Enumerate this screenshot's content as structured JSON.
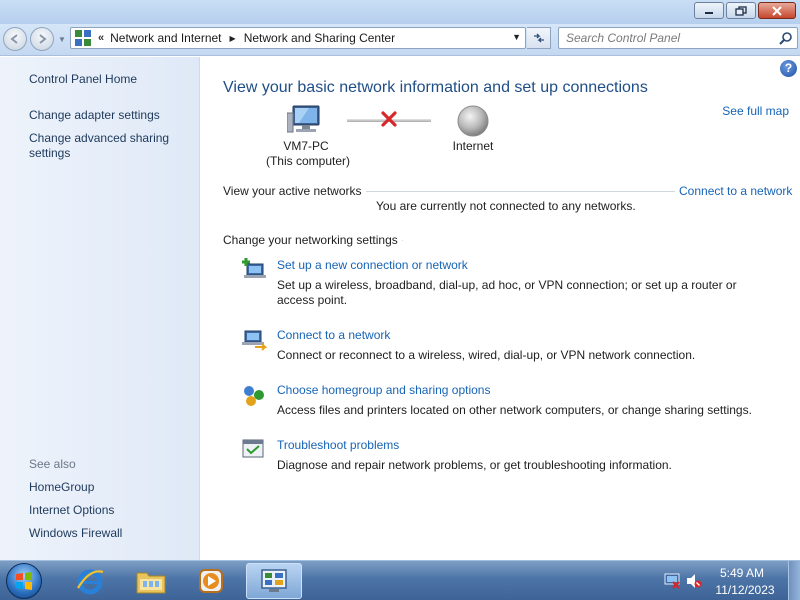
{
  "window": {
    "buttons": [
      "minimize",
      "maximize",
      "close"
    ]
  },
  "navigation": {
    "breadcrumb": [
      "Network and Internet",
      "Network and Sharing Center"
    ],
    "overflow_marker": "«",
    "search": {
      "placeholder": "Search Control Panel",
      "value": ""
    }
  },
  "sidebar": {
    "home": "Control Panel Home",
    "links": [
      "Change adapter settings",
      "Change advanced sharing",
      "settings"
    ],
    "see_also_label": "See also",
    "see_also": [
      "HomeGroup",
      "Internet Options",
      "Windows Firewall"
    ]
  },
  "main": {
    "help_label": "?",
    "title": "View your basic network information and set up connections",
    "see_full_map": "See full map",
    "map": {
      "computer_name": "VM7-PC",
      "computer_sub": "(This computer)",
      "destination": "Internet",
      "status": "disconnected"
    },
    "active_networks": {
      "heading": "View your active networks",
      "connect_link": "Connect to a network",
      "status_text": "You are currently not connected to any networks."
    },
    "settings": {
      "heading": "Change your networking settings",
      "tasks": [
        {
          "icon": "new-connection-icon",
          "link": "Set up a new connection or network",
          "desc": "Set up a wireless, broadband, dial-up, ad hoc, or VPN connection; or set up a router or access point."
        },
        {
          "icon": "connect-network-icon",
          "link": "Connect to a network",
          "desc": "Connect or reconnect to a wireless, wired, dial-up, or VPN network connection."
        },
        {
          "icon": "homegroup-icon",
          "link": "Choose homegroup and sharing options",
          "desc": "Access files and printers located on other network computers, or change sharing settings."
        },
        {
          "icon": "troubleshoot-icon",
          "link": "Troubleshoot problems",
          "desc": "Diagnose and repair network problems, or get troubleshooting information."
        }
      ]
    }
  },
  "taskbar": {
    "pinned": [
      "internet-explorer-icon",
      "windows-explorer-icon",
      "media-player-icon",
      "control-panel-icon"
    ],
    "active": "control-panel-icon",
    "clock_time": "5:49 AM",
    "clock_date": "11/12/2023"
  },
  "colors": {
    "link": "#1664b6",
    "title": "#1f4e86",
    "sidebar_text": "#1e395b",
    "taskbar": "#4d74a7"
  }
}
